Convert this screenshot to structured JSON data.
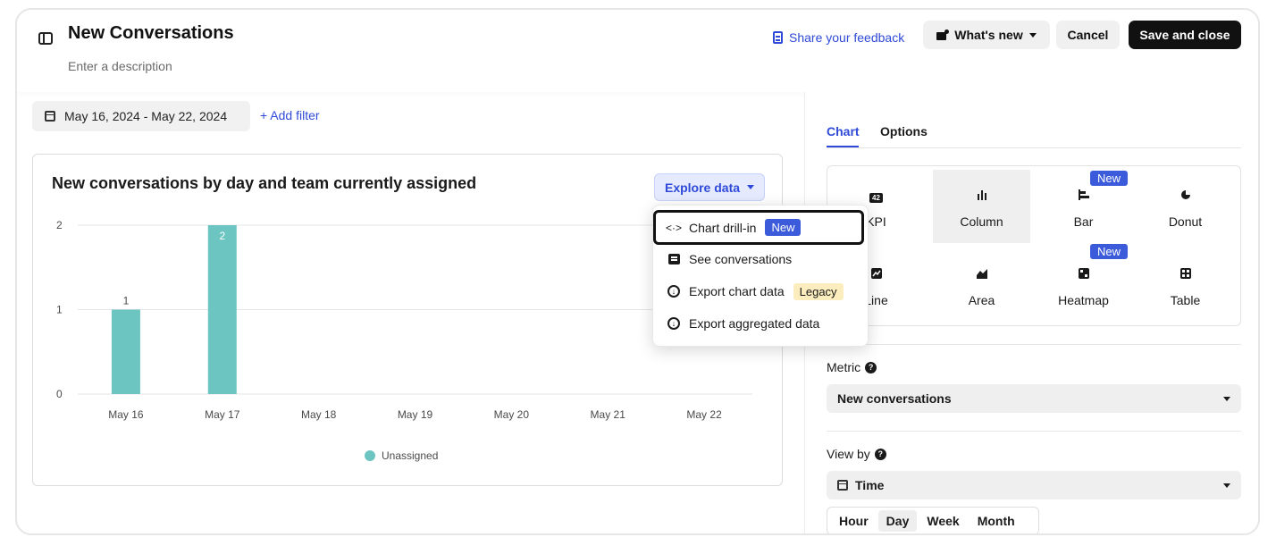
{
  "header": {
    "title": "New Conversations",
    "description_placeholder": "Enter a description",
    "feedback_label": "Share your feedback",
    "whats_new_label": "What's new",
    "cancel_label": "Cancel",
    "save_label": "Save and close"
  },
  "filters": {
    "date_range": "May 16, 2024 - May 22, 2024",
    "add_filter_label": "+ Add filter"
  },
  "card": {
    "title": "New conversations by day and team currently assigned",
    "explore_label": "Explore data"
  },
  "chart_data": {
    "type": "bar",
    "categories": [
      "May 16",
      "May 17",
      "May 18",
      "May 19",
      "May 20",
      "May 21",
      "May 22"
    ],
    "series": [
      {
        "name": "Unassigned",
        "values": [
          1,
          2,
          0,
          0,
          0,
          0,
          0
        ],
        "color": "#6cc5c1"
      }
    ],
    "data_labels": [
      "1",
      "2",
      "",
      "",
      "",
      "",
      ""
    ],
    "y_ticks": [
      "0",
      "1",
      "2"
    ],
    "ylim": [
      0,
      2
    ],
    "legend_position": "bottom-center",
    "grid": true
  },
  "menu": {
    "items": [
      {
        "label": "Chart drill-in",
        "badge": "New",
        "icon": "code-arrows-icon",
        "highlighted": true
      },
      {
        "label": "See conversations",
        "icon": "chat-icon"
      },
      {
        "label": "Export chart data",
        "badge": "Legacy",
        "icon": "download-circle-icon"
      },
      {
        "label": "Export aggregated data",
        "icon": "download-circle-icon"
      }
    ]
  },
  "panel": {
    "tabs": [
      "Chart",
      "Options"
    ],
    "types": [
      {
        "label": "KPI",
        "icon": "42"
      },
      {
        "label": "Column",
        "icon": "column-icon",
        "selected": true
      },
      {
        "label": "Bar",
        "icon": "bar-icon",
        "badge": "New"
      },
      {
        "label": "Donut",
        "icon": "donut-icon"
      },
      {
        "label": "Line",
        "icon": "line-icon"
      },
      {
        "label": "Area",
        "icon": "area-icon"
      },
      {
        "label": "Heatmap",
        "icon": "heatmap-icon",
        "badge": "New"
      },
      {
        "label": "Table",
        "icon": "table-icon"
      }
    ],
    "metric_label": "Metric",
    "metric_value": "New conversations",
    "viewby_label": "View by",
    "viewby_value": "Time",
    "granularity": [
      "Hour",
      "Day",
      "Week",
      "Month"
    ],
    "granularity_selected": "Day"
  },
  "colors": {
    "accent": "#2f4ad8",
    "bar": "#6cc5c1",
    "badge_new": "#3b5bdb",
    "badge_legacy": "#fbedbe"
  }
}
